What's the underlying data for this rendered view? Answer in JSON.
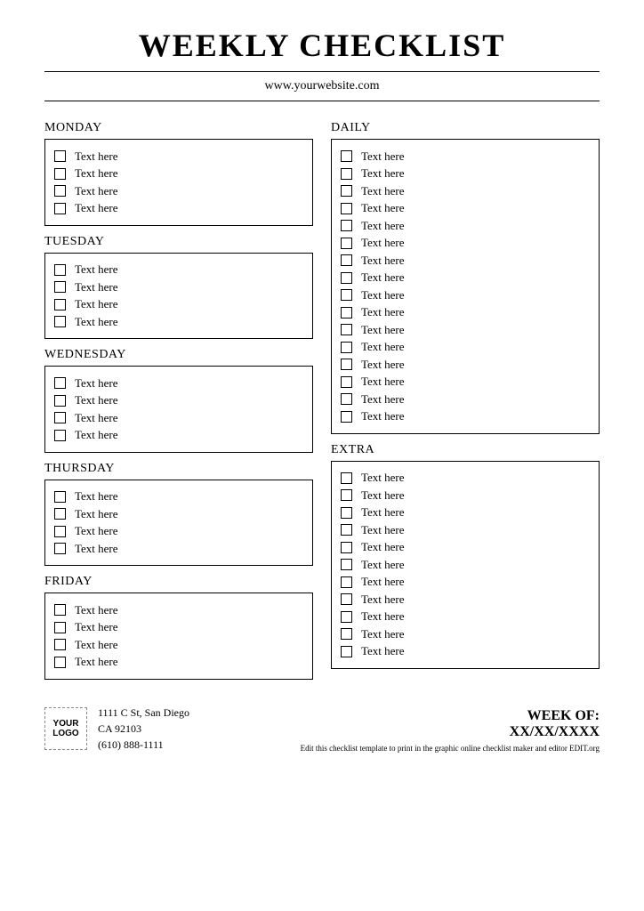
{
  "title": "WEEKLY CHECKLIST",
  "subtitle": "www.yourwebsite.com",
  "left_sections": [
    {
      "title": "MONDAY",
      "items": [
        "Text here",
        "Text here",
        "Text here",
        "Text here"
      ]
    },
    {
      "title": "TUESDAY",
      "items": [
        "Text here",
        "Text here",
        "Text here",
        "Text here"
      ]
    },
    {
      "title": "WEDNESDAY",
      "items": [
        "Text here",
        "Text here",
        "Text here",
        "Text here"
      ]
    },
    {
      "title": "THURSDAY",
      "items": [
        "Text here",
        "Text here",
        "Text here",
        "Text here"
      ]
    },
    {
      "title": "FRIDAY",
      "items": [
        "Text here",
        "Text here",
        "Text here",
        "Text here"
      ]
    }
  ],
  "right_sections": [
    {
      "title": "DAILY",
      "items": [
        "Text here",
        "Text here",
        "Text here",
        "Text here",
        "Text here",
        "Text here",
        "Text here",
        "Text here",
        "Text here",
        "Text here",
        "Text here",
        "Text here",
        "Text here",
        "Text here",
        "Text here",
        "Text here"
      ]
    },
    {
      "title": "EXTRA",
      "items": [
        "Text here",
        "Text here",
        "Text here",
        "Text here",
        "Text here",
        "Text here",
        "Text here",
        "Text here",
        "Text here",
        "Text here",
        "Text here"
      ]
    }
  ],
  "logo_text": "YOUR LOGO",
  "contact": {
    "line1": "1111 C St, San Diego",
    "line2": "CA 92103",
    "line3": "(610) 888-1111"
  },
  "week_label": "WEEK OF:",
  "week_date": "XX/XX/XXXX",
  "footnote": "Edit this checklist template to print in the graphic online checklist maker and editor EDIT.org"
}
